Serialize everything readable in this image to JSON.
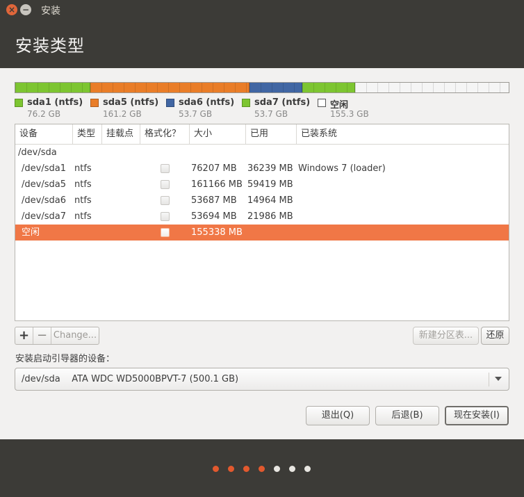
{
  "window": {
    "title": "安装"
  },
  "header": {
    "title": "安装类型"
  },
  "partition_bar": {
    "segments": [
      {
        "name": "sda1 (ntfs)",
        "size": "76.2 GB",
        "color": "#7dc531",
        "fraction": 0.1523
      },
      {
        "name": "sda5 (ntfs)",
        "size": "161.2 GB",
        "color": "#e97d28",
        "fraction": 0.3223
      },
      {
        "name": "sda6 (ntfs)",
        "size": "53.7 GB",
        "color": "#4166a3",
        "fraction": 0.1073
      },
      {
        "name": "sda7 (ntfs)",
        "size": "53.7 GB",
        "color": "#7dc531",
        "fraction": 0.1074
      },
      {
        "name": "空闲",
        "size": "155.3 GB",
        "color": "#f5f5f5",
        "fraction": 0.3106
      }
    ]
  },
  "table": {
    "columns": [
      "设备",
      "类型",
      "挂载点",
      "格式化？",
      "大小",
      "已用",
      "已装系统"
    ],
    "rows": [
      {
        "device": "/dev/sda",
        "type": "",
        "mount": "",
        "format": null,
        "size": "",
        "used": "",
        "system": "",
        "selected": false
      },
      {
        "device": "/dev/sda1",
        "type": "ntfs",
        "mount": "",
        "format": false,
        "size": "76207 MB",
        "used": "36239 MB",
        "system": "Windows 7 (loader)",
        "selected": false
      },
      {
        "device": "/dev/sda5",
        "type": "ntfs",
        "mount": "",
        "format": false,
        "size": "161166 MB",
        "used": "59419 MB",
        "system": "",
        "selected": false
      },
      {
        "device": "/dev/sda6",
        "type": "ntfs",
        "mount": "",
        "format": false,
        "size": "53687 MB",
        "used": "14964 MB",
        "system": "",
        "selected": false
      },
      {
        "device": "/dev/sda7",
        "type": "ntfs",
        "mount": "",
        "format": false,
        "size": "53694 MB",
        "used": "21986 MB",
        "system": "",
        "selected": false
      },
      {
        "device": "空闲",
        "type": "",
        "mount": "",
        "format": false,
        "size": "155338 MB",
        "used": "",
        "system": "",
        "selected": true
      }
    ]
  },
  "toolbar": {
    "add_label": "+",
    "remove_label": "−",
    "change_label": "Change...",
    "new_table_label": "新建分区表...",
    "revert_label": "还原"
  },
  "bootloader": {
    "label": "安装启动引导器的设备：",
    "value": "/dev/sda    ATA WDC WD5000BPVT-7 (500.1 GB)"
  },
  "actions": {
    "quit_label": "退出(Q)",
    "back_label": "后退(B)",
    "install_label": "现在安装(I)"
  },
  "progress": {
    "total_steps": 7,
    "completed_steps": 4
  },
  "colors": {
    "accent": "#f07746",
    "titlebar": "#3c3b37"
  }
}
